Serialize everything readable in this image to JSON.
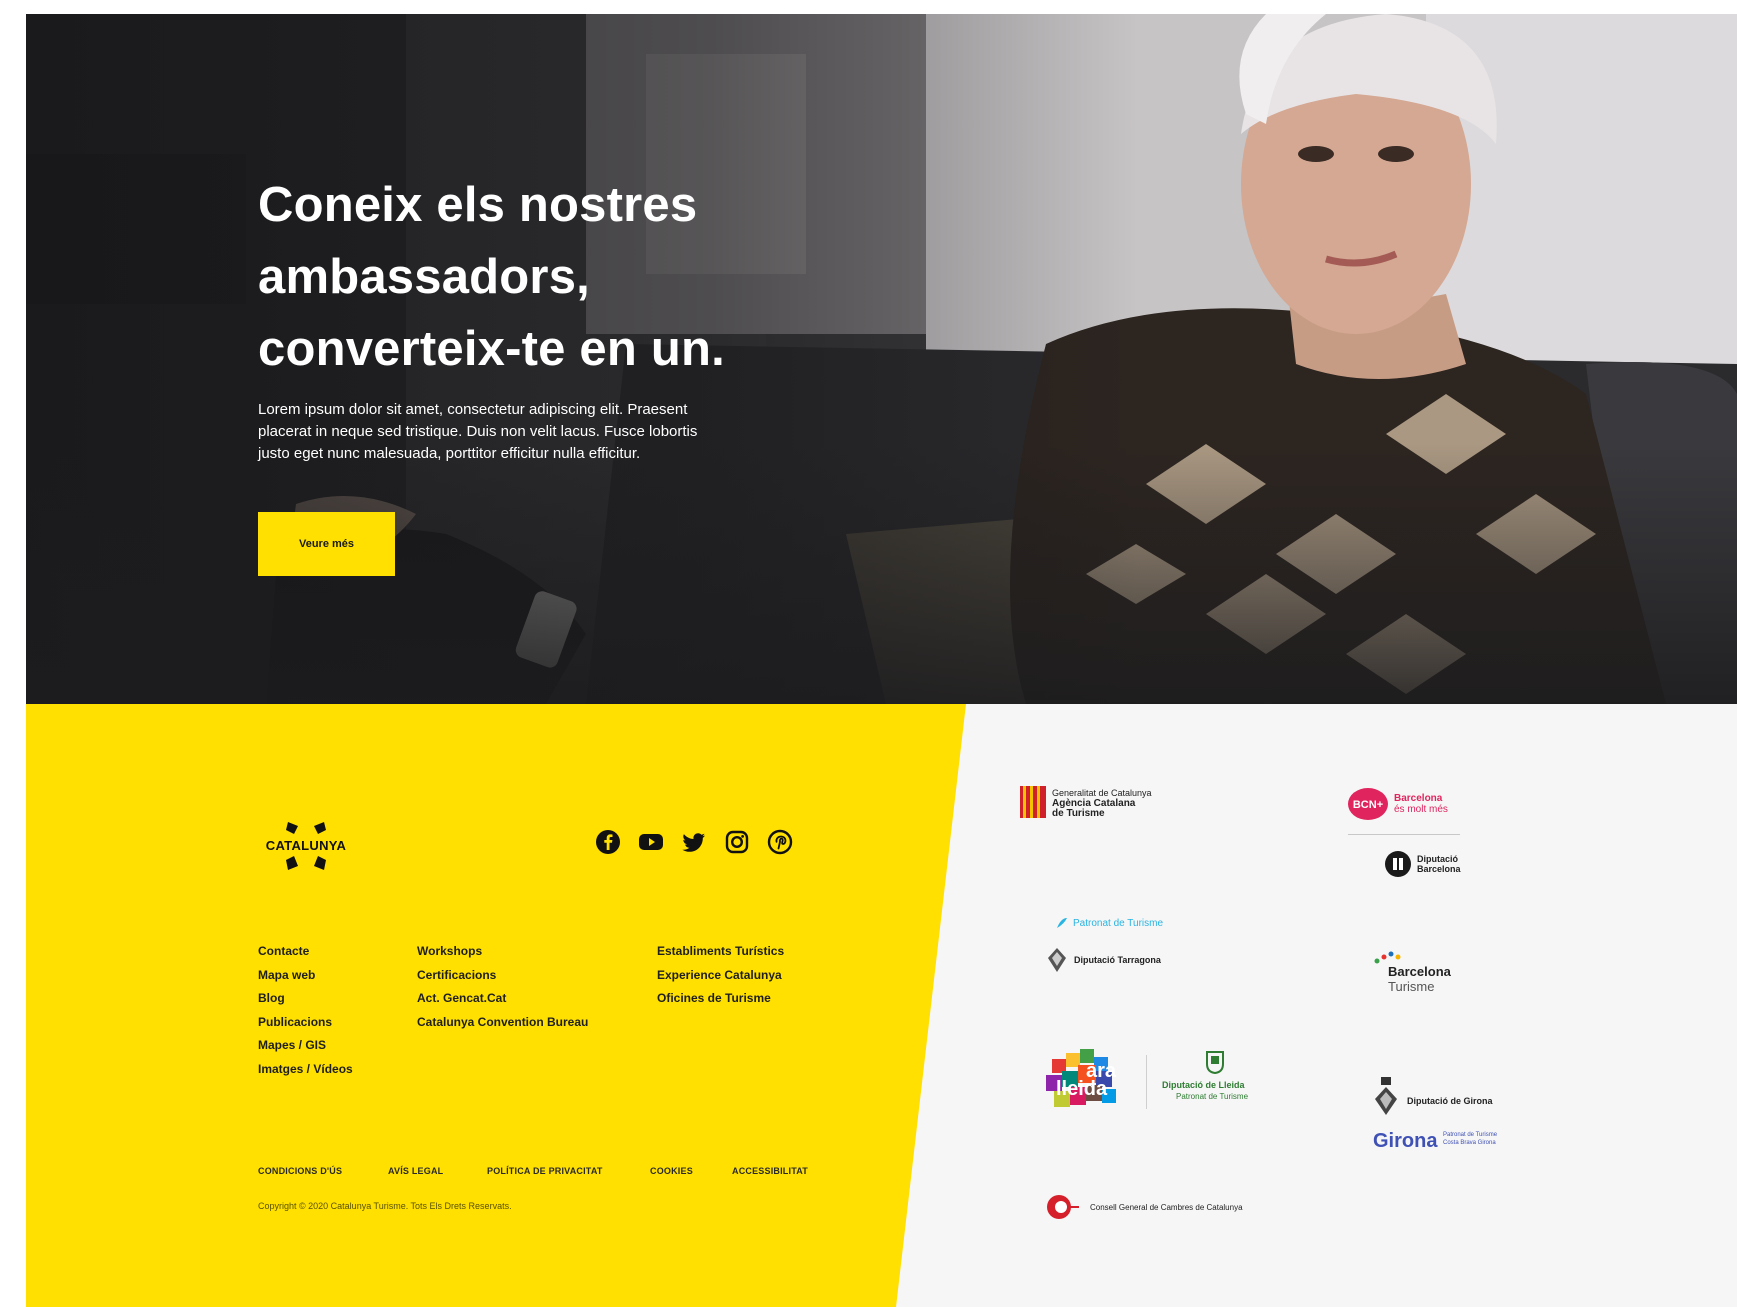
{
  "hero": {
    "title": "Coneix els nostres ambassadors, converteix-te en un.",
    "body": "Lorem ipsum dolor sit amet, consectetur adipiscing elit. Praesent placerat in neque sed tristique. Duis non velit lacus. Fusce lobortis justo eget nunc malesuada, porttitor efficitur nulla efficitur.",
    "button_label": "Veure més"
  },
  "footer": {
    "brand": "CATALUNYA",
    "social": [
      "facebook-icon",
      "youtube-icon",
      "twitter-icon",
      "instagram-icon",
      "pinterest-icon"
    ],
    "links_col1": [
      "Contacte",
      "Mapa web",
      "Blog",
      "Publicacions",
      "Mapes / GIS",
      "Imatges / Vídeos"
    ],
    "links_col2": [
      "Workshops",
      "Certificacions",
      "Act. Gencat.Cat",
      "Catalunya Convention Bureau"
    ],
    "links_col3": [
      "Establiments Turístics",
      "Experience Catalunya",
      "Oficines de Turisme"
    ],
    "legal": [
      "CONDICIONS D'ÚS",
      "AVÍS LEGAL",
      "POLÍTICA DE PRIVACITAT",
      "COOKIES",
      "ACCESSIBILITAT"
    ],
    "copyright": "Copyright © 2020 Catalunya Turisme. Tots Els Drets Reservats.",
    "colors": {
      "yellow": "#ffe000",
      "text": "#1f1f1f"
    }
  },
  "partners": {
    "generalitat": [
      "Generalitat de Catalunya",
      "Agència Catalana",
      "de Turisme"
    ],
    "barcelona_es_molt_mes": [
      "Barcelona",
      "és molt més"
    ],
    "diputacio_barcelona": [
      "Diputació",
      "Barcelona"
    ],
    "patronat_tarragona": "Patronat de Turisme",
    "diputacio_tarragona": "Diputació Tarragona",
    "barcelona_turisme": [
      "Barcelona",
      "Turisme"
    ],
    "ara_lleida": [
      "ara",
      "lleida"
    ],
    "diputacio_lleida": [
      "Diputació de Lleida",
      "Patronat de Turisme"
    ],
    "diputacio_girona": "Diputació de Girona",
    "girona": "Girona",
    "girona_sub": [
      "Patronat de Turisme",
      "Costa Brava Girona"
    ],
    "consell_cambres": "Consell General de Cambres de Catalunya"
  }
}
